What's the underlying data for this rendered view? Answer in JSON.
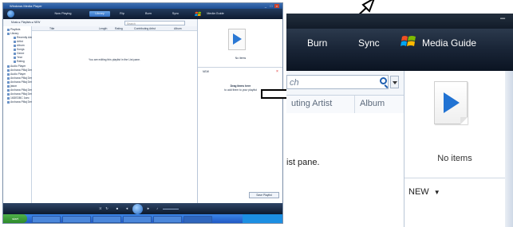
{
  "thumbnail": {
    "window_title": "Windows Media Player",
    "tabs": [
      "Now Playing",
      "Library",
      "Rip",
      "Burn",
      "Sync",
      "Media Guide"
    ],
    "active_tab": "Library",
    "breadcrumb": "Music ▸ Playlists ▸ NEW",
    "search_placeholder": "Search",
    "tree_items": [
      "Playlists",
      "Library",
      "Recently Added",
      "Artist",
      "Album",
      "Songs",
      "Genre",
      "Year",
      "Rating",
      "Audio Player",
      "Archana Pillaj Denver",
      "Audio Player",
      "Archana Pillaj Denver",
      "Archana Pillaj Denver",
      "jason",
      "Archana Pillaj Denver",
      "Archana Pillaj Denver",
      "16DEDBC 1sec",
      "Archana Pillaj Denver"
    ],
    "columns": [
      "Title",
      "Length",
      "Rating",
      "Contributing Artist",
      "Album"
    ],
    "empty_message": "You are editing this playlist in the List pane.",
    "list_pane": {
      "no_items": "No items",
      "playlist_name": "NEW",
      "drag_title": "Drag items here",
      "drag_subtitle": "to add them to your playlist",
      "save_button": "Save Playlist"
    },
    "taskbar": {
      "start": "start",
      "buttons": [
        "Webmail",
        "Microsoft...",
        "3 Intern...",
        "Untitled...",
        "Untitled...",
        "Windows..."
      ]
    }
  },
  "zoom": {
    "tabs": {
      "burn": "Burn",
      "sync": "Sync",
      "media_guide": "Media Guide"
    },
    "window_dash": "–",
    "search_placeholder": "ch",
    "columns": {
      "contributing_artist": "uting Artist",
      "album": "Album"
    },
    "library_message": "ist pane.",
    "list_pane": {
      "no_items": "No items",
      "playlist_button": "NEW"
    }
  },
  "colors": {
    "accent": "#2173d3",
    "tab_bar": "#1a2638",
    "arrow": "#000000"
  }
}
